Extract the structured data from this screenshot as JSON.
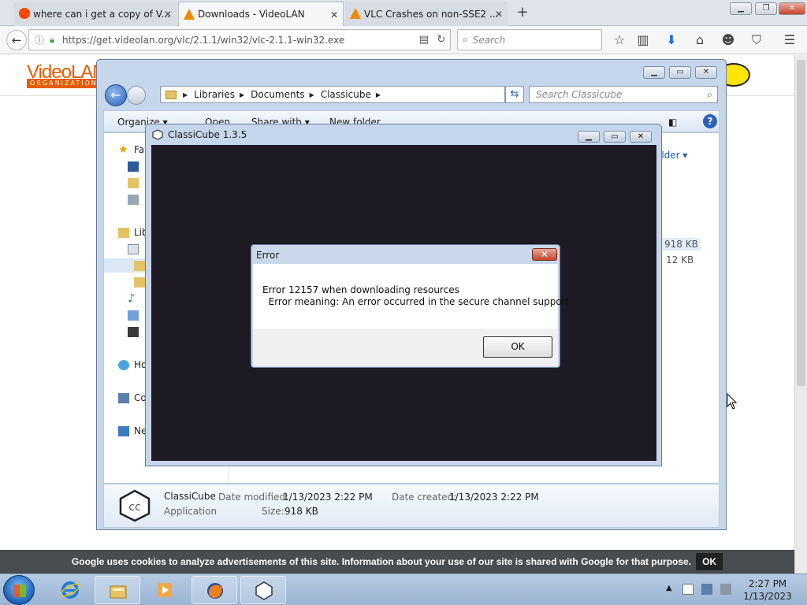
{
  "browser": {
    "tabs": [
      {
        "label": "where can i get a copy of V...",
        "state": "inactive",
        "icon": "reddit-icon"
      },
      {
        "label": "Downloads - VideoLAN",
        "state": "active",
        "icon": "vlc-cone-icon"
      },
      {
        "label": "VLC Crashes on non-SSE2 ...",
        "state": "inactive",
        "icon": "vlc-cone-icon"
      }
    ],
    "url": "https://get.videolan.org/vlc/2.1.1/win32/vlc-2.1.1-win32.exe",
    "search_placeholder": "Search"
  },
  "page": {
    "logo_text": "VideoLAN",
    "logo_sub": "ORGANIZATION",
    "cookie_text": "Google uses cookies to analyze advertisements of this site. Information about your use of our site is shared with Google for that purpose.",
    "cookie_ok": "OK"
  },
  "explorer": {
    "breadcrumb": [
      "Libraries",
      "Documents",
      "Classicube"
    ],
    "search_placeholder": "Search Classicube",
    "commands": {
      "organize": "Organize ▾",
      "open": "Open",
      "share": "Share with ▾",
      "new_folder": "New folder",
      "folder": "older ▾"
    },
    "nav": {
      "favorites": "Fa",
      "libraries": "Lib",
      "homegroup": "Ho",
      "computer": "Co",
      "network": "Ne"
    },
    "sizes": [
      "918 KB",
      "12 KB"
    ],
    "details": {
      "name": "ClassiCube",
      "type": "Application",
      "modified_label": "Date modified:",
      "modified_value": "1/13/2023 2:22 PM",
      "created_label": "Date created:",
      "created_value": "1/13/2023 2:22 PM",
      "size_label": "Size:",
      "size_value": "918 KB"
    }
  },
  "classicube": {
    "title": "ClassiCube 1.3.5"
  },
  "error_dialog": {
    "title": "Error",
    "line1": "Error 12157 when downloading resources",
    "line2": "  Error meaning: An error occurred in the secure channel support",
    "ok": "OK"
  },
  "taskbar": {
    "time": "2:27 PM",
    "date": "1/13/2023",
    "apps": [
      "explorer-icon",
      "internet-explorer-icon",
      "file-explorer-icon",
      "media-player-icon",
      "firefox-icon",
      "classicube-icon"
    ]
  }
}
